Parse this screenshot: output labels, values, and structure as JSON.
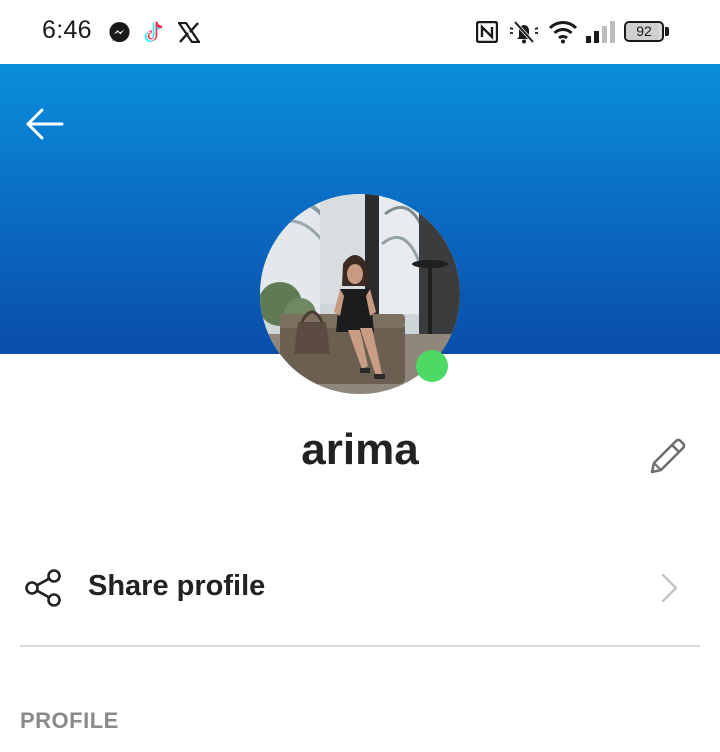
{
  "status_bar": {
    "time": "6:46",
    "battery_level": "92",
    "left_icons": [
      "messenger-icon",
      "tiktok-icon",
      "x-icon"
    ],
    "right_icons": [
      "nfc-icon",
      "mute-icon",
      "wifi-icon",
      "signal-icon",
      "battery-icon"
    ]
  },
  "header": {
    "back_icon": "arrow-left-icon",
    "gradient_top": "#0a8fdc",
    "gradient_bottom": "#0a4ea8"
  },
  "profile": {
    "name": "arima",
    "presence": "online",
    "presence_color": "#4cd964",
    "edit_icon": "pencil-icon"
  },
  "actions": {
    "share_label": "Share profile",
    "share_icon": "share-icon",
    "chevron_icon": "chevron-right-icon"
  },
  "sections": {
    "profile_label": "PROFILE"
  }
}
